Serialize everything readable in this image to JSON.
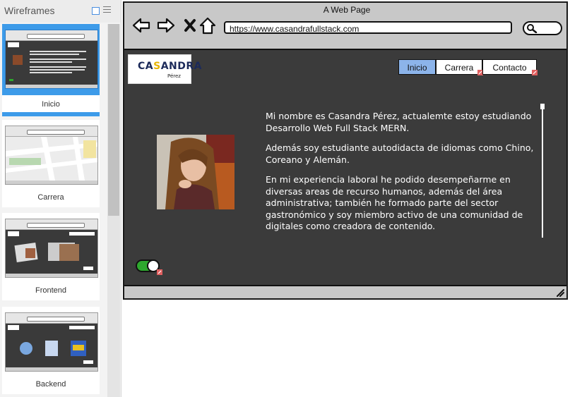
{
  "panel": {
    "title": "Wireframes",
    "pages": [
      {
        "label": "Inicio",
        "active": true
      },
      {
        "label": "Carrera",
        "active": false
      },
      {
        "label": "Frontend",
        "active": false
      },
      {
        "label": "Backend",
        "active": false
      }
    ]
  },
  "browser": {
    "window_title": "A Web Page",
    "url": "https://www.casandrafullstack.com",
    "nav_icons": [
      "back-arrow-icon",
      "forward-arrow-icon",
      "stop-x-icon",
      "home-icon"
    ],
    "search_icon": "search-icon"
  },
  "site": {
    "logo_main_a": "CA",
    "logo_main_accent": "S",
    "logo_main_b": "ANDRA",
    "logo_sub": "Pérez",
    "nav": {
      "inicio": "Inicio",
      "carrera": "Carrera",
      "contacto": "Contacto"
    },
    "paragraphs": {
      "p1": "Mi nombre es Casandra Pérez, actualemte estoy estudiando Desarrollo Web Full Stack MERN.",
      "p2": "Además soy estudiante autodidacta de idiomas como Chino, Coreano y Alemán.",
      "p3": "En mi experiencia laboral he podido desempeñarme en diversas areas de recurso humanos, además del área administrativa; también he formado parte del sector gastronómico y soy miembro activo de una comunidad de digitales como creadora de contenido."
    },
    "toggle_on": true
  },
  "colors": {
    "viewport_bg": "#3b3b3b",
    "nav_selected": "#8cb4ea",
    "panel_active": "#3d9be9",
    "toggle_on": "#2ea82e"
  }
}
